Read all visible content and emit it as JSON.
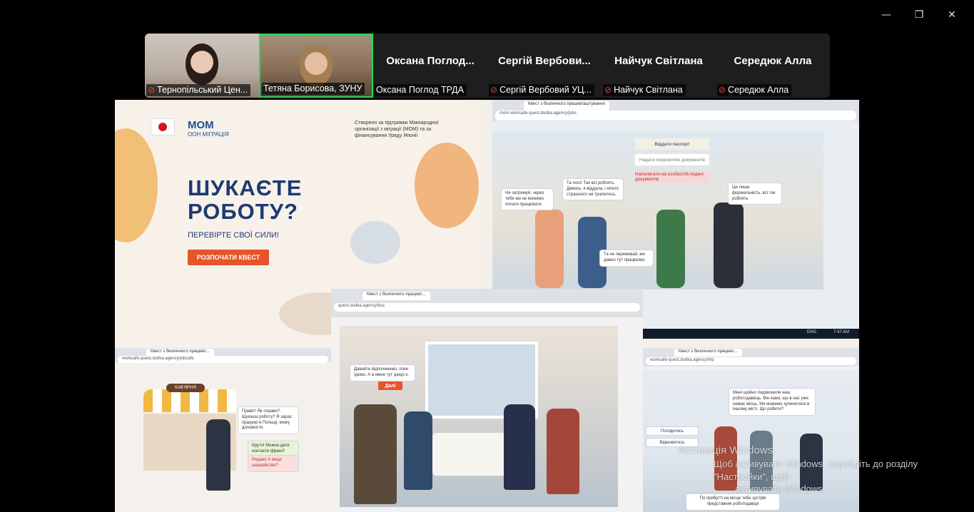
{
  "window_controls": {
    "minimize": "—",
    "restore": "❐",
    "close": "✕"
  },
  "participants": [
    {
      "label": "Тернопільський Цен...",
      "display": "",
      "muted": true,
      "video": true
    },
    {
      "label": "Тетяна Борисова, ЗУНУ",
      "display": "",
      "muted": false,
      "video": true,
      "active_speaker": true
    },
    {
      "label": "Оксана Поглод ТРДА",
      "display": "Оксана  Поглод...",
      "muted": false,
      "video": false
    },
    {
      "label": "Сергій Вербовий УЦ...",
      "display": "Сергій  Вербови...",
      "muted": true,
      "video": false
    },
    {
      "label": "Найчук Світлана",
      "display": "Найчук Світлана",
      "muted": true,
      "video": false
    },
    {
      "label": "Середюк Алла",
      "display": "Середюк Алла",
      "muted": true,
      "video": false
    }
  ],
  "landing": {
    "logo": "МОМ",
    "logo_sub": "ООН МІГРАЦІЯ",
    "note": "Створено за підтримки Міжнародної організації з міграції (МОМ) та за фінансування Уряду Японії",
    "headline_1": "ШУКАЄТЕ",
    "headline_2": "РОБОТУ?",
    "subheadline": "ПЕРЕВІРТЕ СВОЇ СИЛИ!",
    "cta": "РОЗПОЧАТИ КВЕСТ"
  },
  "quest1": {
    "tab": "Квест з безпечного працевлаштування",
    "url": "mom-worksafe-quest.dudka.agency/jobs",
    "options": [
      "Віддати паспорт",
      "Надати ксерокопію документів",
      "Наполягати на особистій подачі документів"
    ],
    "bubble_left": "Не затримуй, через тебе ми не можемо почати працювати",
    "bubble_mid": "Та чого! Так всі роблять. Дивись, я віддала, і нічого страшного не трапилось.",
    "bubble_right": "Це лише формальність, всі так роблять",
    "bubble_bottom": "Та не переживай, ми давно тут працюємо.",
    "time": "7:47 AM",
    "lang": "ENG"
  },
  "cafe": {
    "tab": "Квест з безпечного працевл...",
    "url": "worksafe-quest.dudka.agency/jobcafe",
    "sign": "КАВ'ЯРНЯ",
    "bubble": "Привіт! Як справи? Шукаєш роботу? Я зараз працюю в Польщі, можу допомогти.",
    "reply1": "Круто! Можна дати контакти фірми?",
    "reply2": "Ридаю! А якщо шахрайство?"
  },
  "bus": {
    "tab": "Квест з безпечного працевл...",
    "url": "quest.dudka.agency/bus",
    "bubble": "Давайте відпочинемо, поки їдемо. А в мене тут дещо є.",
    "button": "Далі"
  },
  "quest3": {
    "tab": "Квест з безпечного працевл...",
    "url": "worksafe-quest.dudka.agency/trip",
    "bubble": "Мені щойно подзвонили наш роботодавець. Він каже, що в нас уже немає місць. Ми можемо зупинитися в іншому місті. Що робити?",
    "btn1": "Погодитись",
    "btn2": "Відмовитись",
    "footer": "По прибутті на місце тебе зустрів представник роботодавця"
  },
  "watermark": {
    "line1": "Активація Windows",
    "line2": "Щоб активувати Windows, перейдіть до розділу \"Настройки\", щоб",
    "line3": "активувати Windows."
  }
}
